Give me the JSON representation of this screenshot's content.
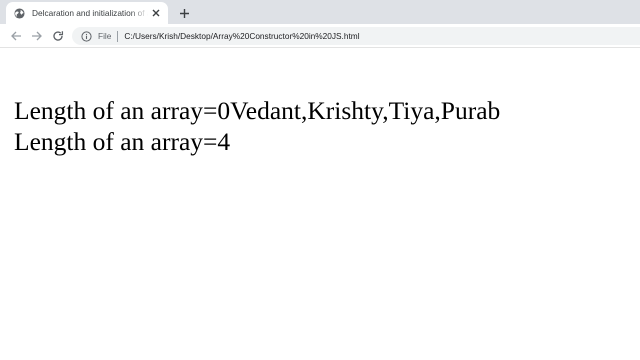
{
  "browser": {
    "tab": {
      "title": "Delcaration and initialization of a",
      "favicon": "globe-icon",
      "close_icon": "close-icon"
    },
    "new_tab_icon": "plus-icon",
    "toolbar": {
      "back_icon": "back-arrow-icon",
      "forward_icon": "forward-arrow-icon",
      "reload_icon": "reload-icon",
      "info_icon": "info-icon",
      "scheme_label": "File",
      "url": "C:/Users/Krish/Desktop/Array%20Constructor%20in%20JS.html"
    }
  },
  "page": {
    "lines": [
      "Length of an array=0Vedant,Krishty,Tiya,Purab",
      "Length of an array=4"
    ]
  },
  "colors": {
    "tabstrip_bg": "#dee1e6",
    "omnibox_bg": "#f1f3f4",
    "icon": "#5f6368",
    "text": "#000000"
  }
}
